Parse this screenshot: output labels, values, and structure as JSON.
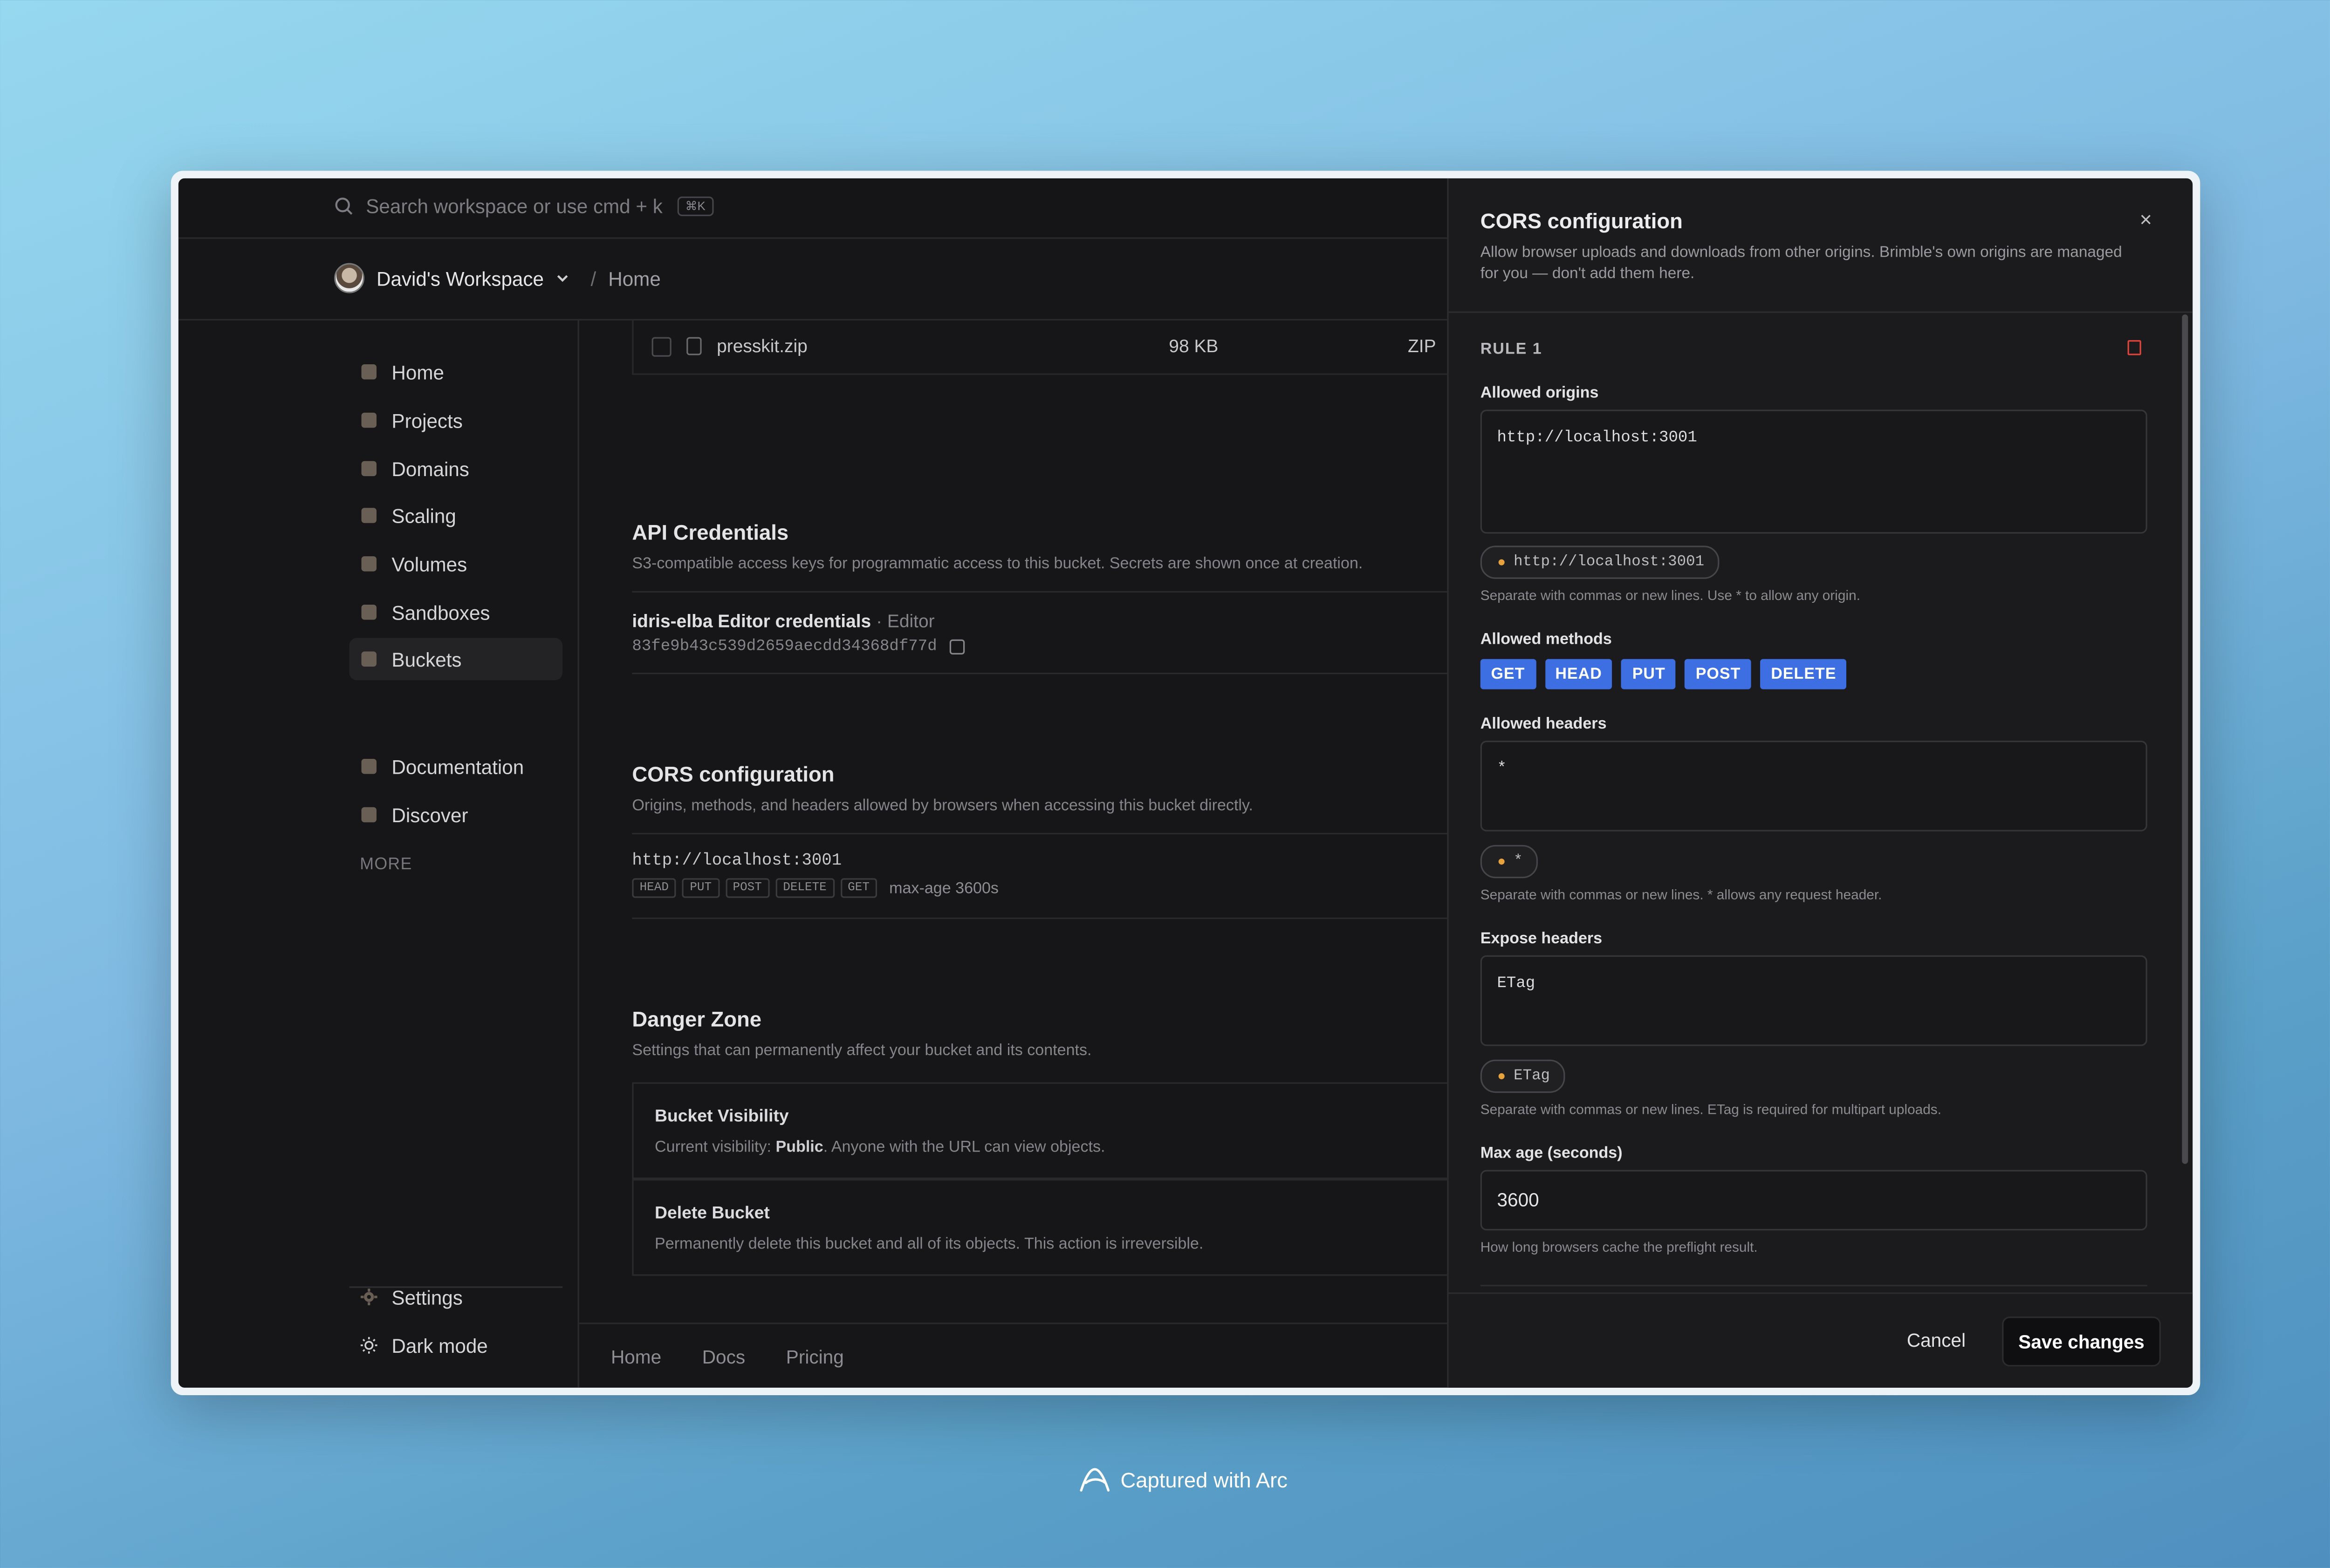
{
  "topbar": {
    "search_placeholder": "Search workspace or use cmd + k",
    "shortcut": "⌘K"
  },
  "breadcrumb": {
    "workspace": "David's Workspace",
    "separator": "/",
    "current": "Home"
  },
  "sidebar": {
    "items": [
      {
        "label": "Home",
        "icon": "home-icon"
      },
      {
        "label": "Projects",
        "icon": "projects-icon"
      },
      {
        "label": "Domains",
        "icon": "domains-icon"
      },
      {
        "label": "Scaling",
        "icon": "scaling-icon"
      },
      {
        "label": "Volumes",
        "icon": "volumes-icon"
      },
      {
        "label": "Sandboxes",
        "icon": "sandboxes-icon"
      },
      {
        "label": "Buckets",
        "icon": "buckets-icon",
        "active": true
      }
    ],
    "more_label": "MORE",
    "more_items": [
      {
        "label": "Documentation",
        "icon": "documentation-icon"
      },
      {
        "label": "Discover",
        "icon": "discover-icon"
      }
    ],
    "bottom_items": [
      {
        "label": "Settings",
        "icon": "gear-icon"
      },
      {
        "label": "Dark mode",
        "icon": "sun-icon"
      }
    ]
  },
  "main": {
    "file": {
      "name": "presskit.zip",
      "size": "98 KB",
      "type": "ZIP"
    },
    "api": {
      "title": "API Credentials",
      "subtitle": "S3-compatible access keys for programmatic access to this bucket. Secrets are shown once at creation.",
      "credential_name": "idris-elba Editor credentials",
      "credential_role": "· Editor",
      "credential_key": "83fe9b43c539d2659aecdd34368df77d"
    },
    "cors": {
      "title": "CORS configuration",
      "subtitle": "Origins, methods, and headers allowed by browsers when accessing this bucket directly.",
      "origin": "http://localhost:3001",
      "methods": [
        "HEAD",
        "PUT",
        "POST",
        "DELETE",
        "GET"
      ],
      "max_age": "max-age 3600s"
    },
    "danger": {
      "title": "Danger Zone",
      "subtitle": "Settings that can permanently affect your bucket and its contents.",
      "visibility_title": "Bucket Visibility",
      "visibility_prefix": "Current visibility:",
      "visibility_value": "Public",
      "visibility_suffix": ". Anyone with the URL can view objects.",
      "delete_title": "Delete Bucket",
      "delete_desc": "Permanently delete this bucket and all of its objects. This action is irreversible."
    }
  },
  "footer": {
    "links": [
      "Home",
      "Docs",
      "Pricing"
    ]
  },
  "panel": {
    "title": "CORS configuration",
    "description": "Allow browser uploads and downloads from other origins. Brimble's own origins are managed for you — don't add them here.",
    "close": "×",
    "rule_label": "RULE 1",
    "origins_label": "Allowed origins",
    "origins_value": "http://localhost:3001",
    "origins_chip": "http://localhost:3001",
    "origins_hint": "Separate with commas or new lines. Use * to allow any origin.",
    "methods_label": "Allowed methods",
    "methods": [
      "GET",
      "HEAD",
      "PUT",
      "POST",
      "DELETE"
    ],
    "headers_label": "Allowed headers",
    "headers_value": "*",
    "headers_chip": "*",
    "headers_hint": "Separate with commas or new lines. * allows any request header.",
    "expose_label": "Expose headers",
    "expose_value": "ETag",
    "expose_chip": "ETag",
    "expose_hint": "Separate with commas or new lines. ETag is required for multipart uploads.",
    "maxage_label": "Max age (seconds)",
    "maxage_value": "3600",
    "maxage_hint": "How long browsers cache the preflight result.",
    "cancel": "Cancel",
    "save": "Save changes",
    "accent_color": "#3d6fe3",
    "danger_color": "#e0453d"
  },
  "capture_label": "Captured with Arc"
}
